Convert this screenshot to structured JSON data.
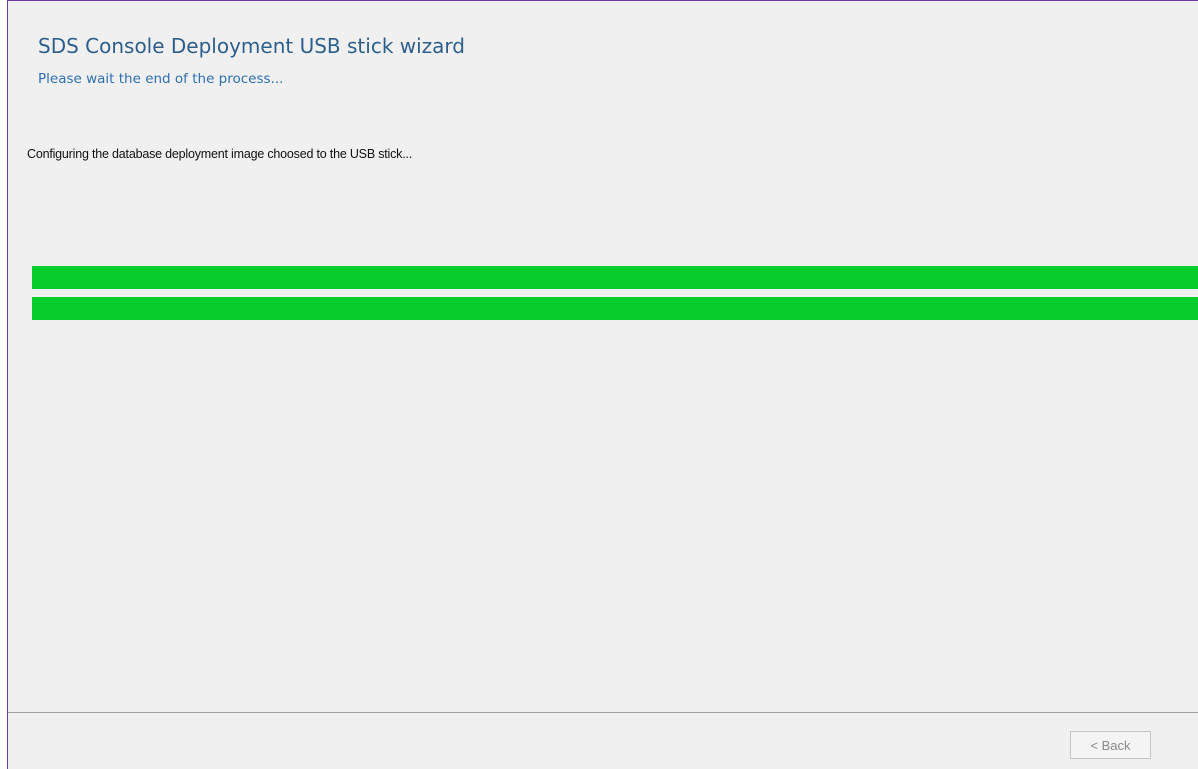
{
  "wizard": {
    "title": "SDS Console Deployment USB stick wizard",
    "subtitle": "Please wait the end of the process..."
  },
  "status": {
    "message": "Configuring the database deployment image choosed to the USB stick..."
  },
  "progress": {
    "overall_percent": 100,
    "step_percent": 100,
    "fill_color": "#06cc2c"
  },
  "footer": {
    "back_label": "< Back",
    "back_enabled": false
  }
}
